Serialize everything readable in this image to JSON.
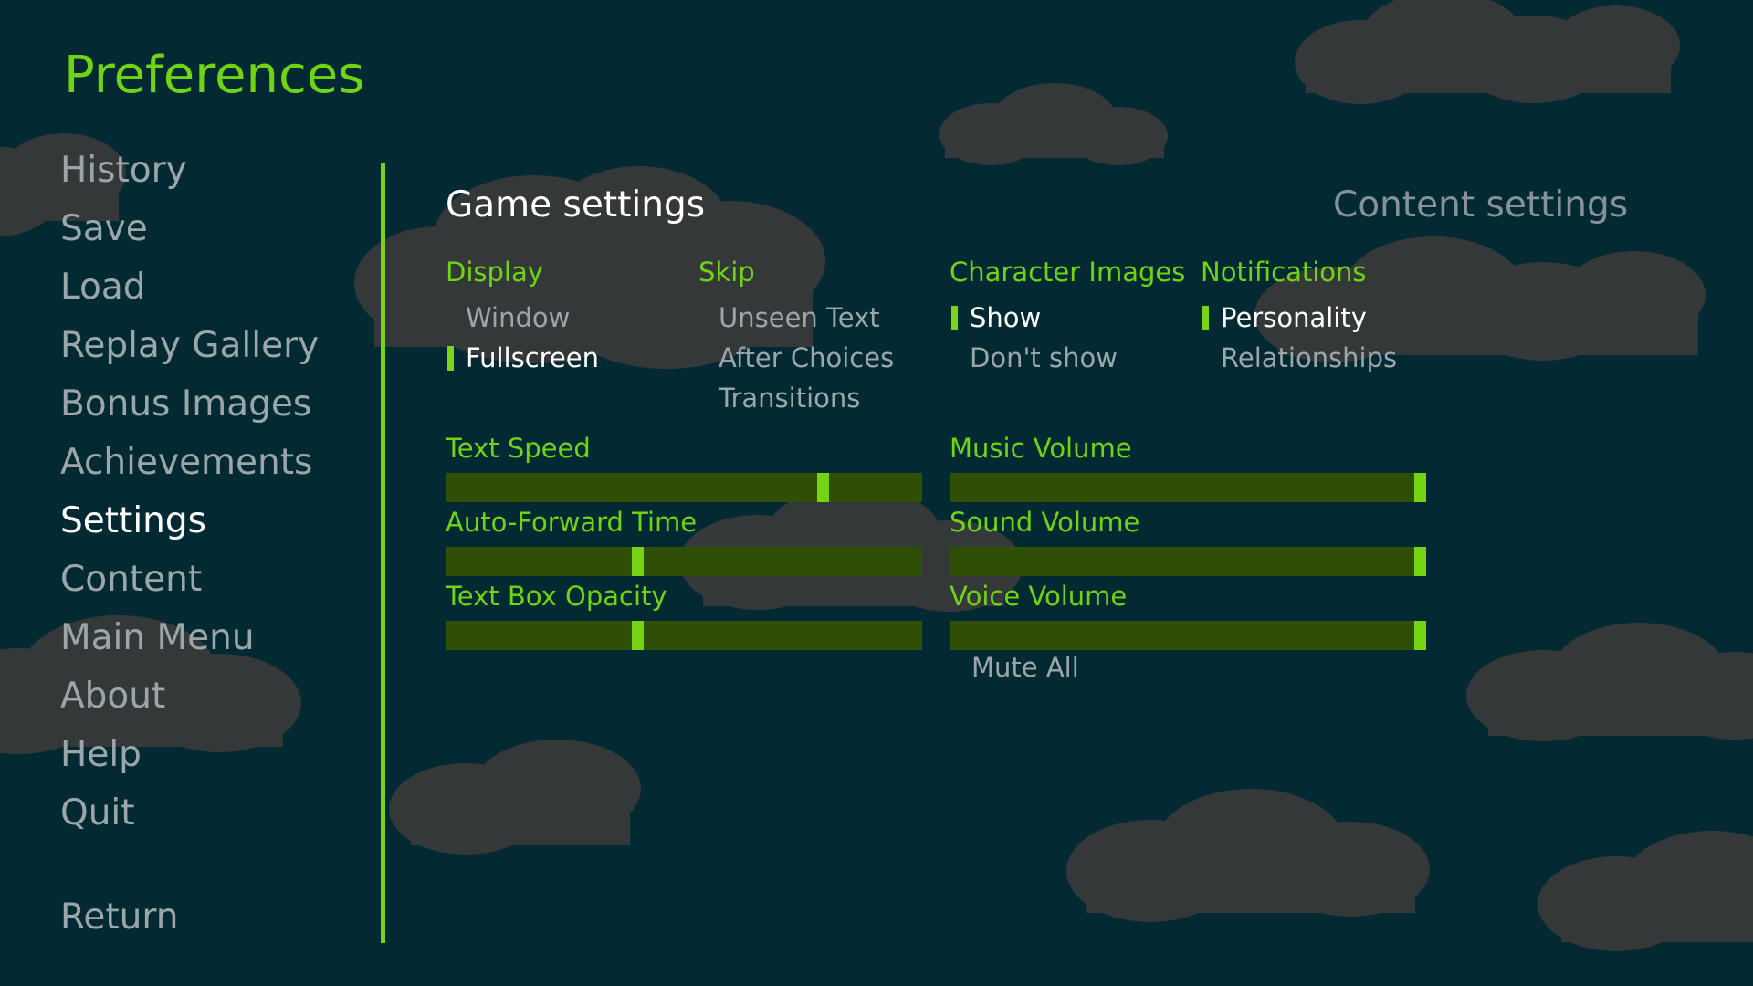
{
  "screen": {
    "title": "Preferences",
    "accent_color": "#6fd411",
    "background_color": "#032a33",
    "selected_text_color": "#ffffff",
    "idle_text_color": "#9aa6a9",
    "slider_track_color": "#2f4f06",
    "slider_thumb_color": "#74d413"
  },
  "nav": {
    "items": [
      {
        "label": "History",
        "selected": false
      },
      {
        "label": "Save",
        "selected": false
      },
      {
        "label": "Load",
        "selected": false
      },
      {
        "label": "Replay Gallery",
        "selected": false
      },
      {
        "label": "Bonus Images",
        "selected": false
      },
      {
        "label": "Achievements",
        "selected": false
      },
      {
        "label": "Settings",
        "selected": true
      },
      {
        "label": "Content",
        "selected": false
      },
      {
        "label": "Main Menu",
        "selected": false
      },
      {
        "label": "About",
        "selected": false
      },
      {
        "label": "Help",
        "selected": false
      },
      {
        "label": "Quit",
        "selected": false
      }
    ],
    "return_label": "Return"
  },
  "tabs": {
    "game": {
      "label": "Game settings",
      "active": true
    },
    "content": {
      "label": "Content settings",
      "active": false
    }
  },
  "option_groups": {
    "display": {
      "heading": "Display",
      "options": [
        {
          "label": "Window",
          "selected": false
        },
        {
          "label": "Fullscreen",
          "selected": true
        }
      ]
    },
    "skip": {
      "heading": "Skip",
      "options": [
        {
          "label": "Unseen Text",
          "selected": false
        },
        {
          "label": "After Choices",
          "selected": false
        },
        {
          "label": "Transitions",
          "selected": false
        }
      ]
    },
    "character_images": {
      "heading": "Character Images",
      "options": [
        {
          "label": "Show",
          "selected": true
        },
        {
          "label": "Don't show",
          "selected": false
        }
      ]
    },
    "notifications": {
      "heading": "Notifications",
      "options": [
        {
          "label": "Personality",
          "selected": true
        },
        {
          "label": "Relationships",
          "selected": false
        }
      ]
    }
  },
  "sliders": {
    "text_speed": {
      "label": "Text Speed",
      "value": 80
    },
    "auto_forward_time": {
      "label": "Auto-Forward Time",
      "value": 40
    },
    "text_box_opacity": {
      "label": "Text Box Opacity",
      "value": 40
    },
    "music_volume": {
      "label": "Music Volume",
      "value": 100
    },
    "sound_volume": {
      "label": "Sound Volume",
      "value": 100
    },
    "voice_volume": {
      "label": "Voice Volume",
      "value": 100
    }
  },
  "mute_all": {
    "label": "Mute All"
  }
}
